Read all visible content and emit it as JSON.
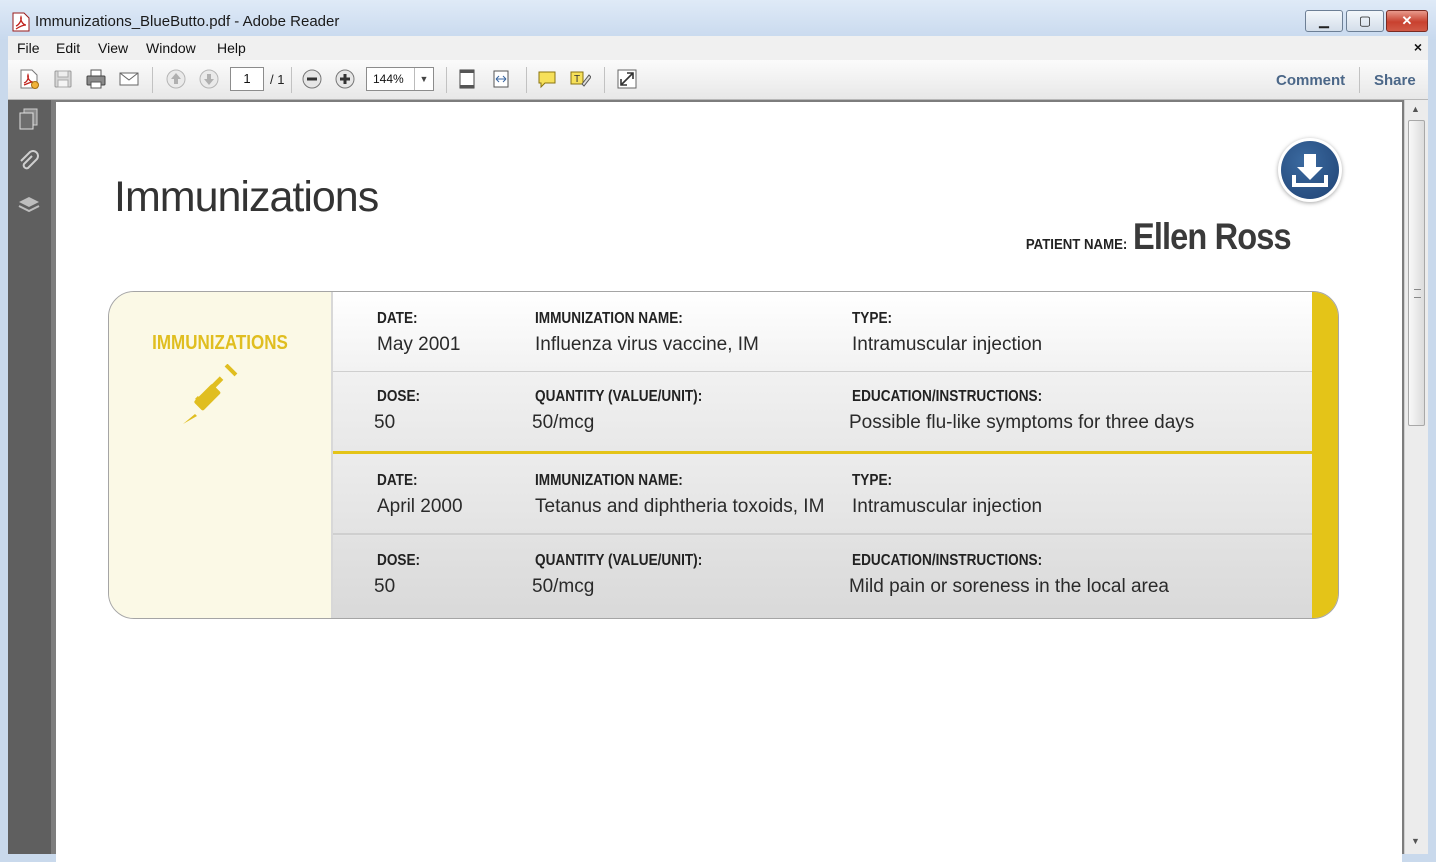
{
  "window": {
    "title": "Immunizations_BlueButto.pdf - Adobe Reader",
    "controls": {
      "minimize": "▁",
      "maximize": "▢",
      "close": "✕"
    }
  },
  "menu": {
    "items": [
      "File",
      "Edit",
      "View",
      "Window",
      "Help"
    ],
    "close_doc": "×"
  },
  "toolbar": {
    "page_current": "1",
    "page_total": "/ 1",
    "zoom": "144%",
    "comment": "Comment",
    "share": "Share"
  },
  "document": {
    "title": "Immunizations",
    "patient_label": "PATIENT NAME:",
    "patient_name": "Ellen Ross",
    "section_heading": "IMMUNIZATIONS",
    "labels": {
      "date": "DATE:",
      "name": "IMMUNIZATION NAME:",
      "type": "TYPE:",
      "dose": "DOSE:",
      "quantity": "QUANTITY (VALUE/UNIT):",
      "education": "EDUCATION/INSTRUCTIONS:"
    },
    "records": [
      {
        "date": "May 2001",
        "name": "Influenza virus vaccine, IM",
        "type": "Intramuscular injection",
        "dose": "50",
        "quantity": "50/mcg",
        "education": "Possible flu-like symptoms for three days"
      },
      {
        "date": "April 2000",
        "name": "Tetanus and diphtheria toxoids, IM",
        "type": "Intramuscular injection",
        "dose": "50",
        "quantity": "50/mcg",
        "education": "Mild pain or soreness in the local area"
      }
    ]
  },
  "colors": {
    "accent_yellow": "#e4c418",
    "download_blue": "#1f4273",
    "link_blue": "#4b6788"
  }
}
